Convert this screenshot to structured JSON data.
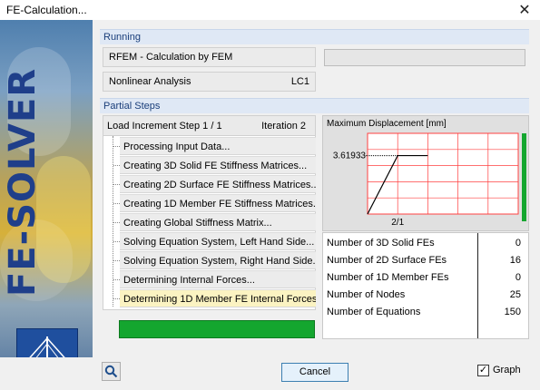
{
  "window": {
    "title": "FE-Calculation..."
  },
  "banner": {
    "word": "FE-SOLVER"
  },
  "running": {
    "header": "Running",
    "program": "RFEM - Calculation by FEM",
    "analysis": "Nonlinear Analysis",
    "load_case": "LC1"
  },
  "partial": {
    "header": "Partial Steps",
    "load_increment": "Load Increment Step 1 / 1",
    "iteration": "Iteration 2",
    "steps": [
      "Processing Input Data...",
      "Creating 3D Solid FE Stiffness Matrices...",
      "Creating 2D Surface FE Stiffness Matrices...",
      "Creating 1D Member FE Stiffness Matrices...",
      "Creating Global Stiffness Matrix...",
      "Solving Equation System, Left Hand Side...",
      "Solving Equation System, Right Hand Side...",
      "Determining Internal Forces...",
      "Determining 1D Member FE Internal Forces..."
    ],
    "active_step_index": 8,
    "progress_fraction": 1.0
  },
  "chart_data": {
    "type": "line",
    "title": "Maximum Displacement [mm]",
    "x_tick_label": "2/1",
    "points": [
      {
        "x": 0,
        "y": 0
      },
      {
        "x": 1,
        "y": 3.61933
      },
      {
        "x": 2,
        "y": 3.61933
      }
    ],
    "y_label_value": "3.61933",
    "xlim": [
      0,
      5
    ],
    "ylim": [
      0,
      5
    ],
    "grid": true,
    "line_color": "#000000",
    "grid_color": "#ff4040",
    "level_color": "#14a62f"
  },
  "stats": [
    {
      "label": "Number of 3D Solid FEs",
      "value": "0"
    },
    {
      "label": "Number of 2D Surface FEs",
      "value": "16"
    },
    {
      "label": "Number of 1D Member FEs",
      "value": "0"
    },
    {
      "label": "Number of Nodes",
      "value": "25"
    },
    {
      "label": "Number of Equations",
      "value": "150"
    }
  ],
  "buttons": {
    "cancel": "Cancel",
    "graph_label": "Graph",
    "graph_checked": "✓",
    "close_glyph": "✕"
  },
  "colors": {
    "section_header_bg": "#dfe8f5",
    "section_header_text": "#1a3e7a",
    "progress_green": "#14a62f",
    "active_step_bg": "#fbf3c2"
  }
}
